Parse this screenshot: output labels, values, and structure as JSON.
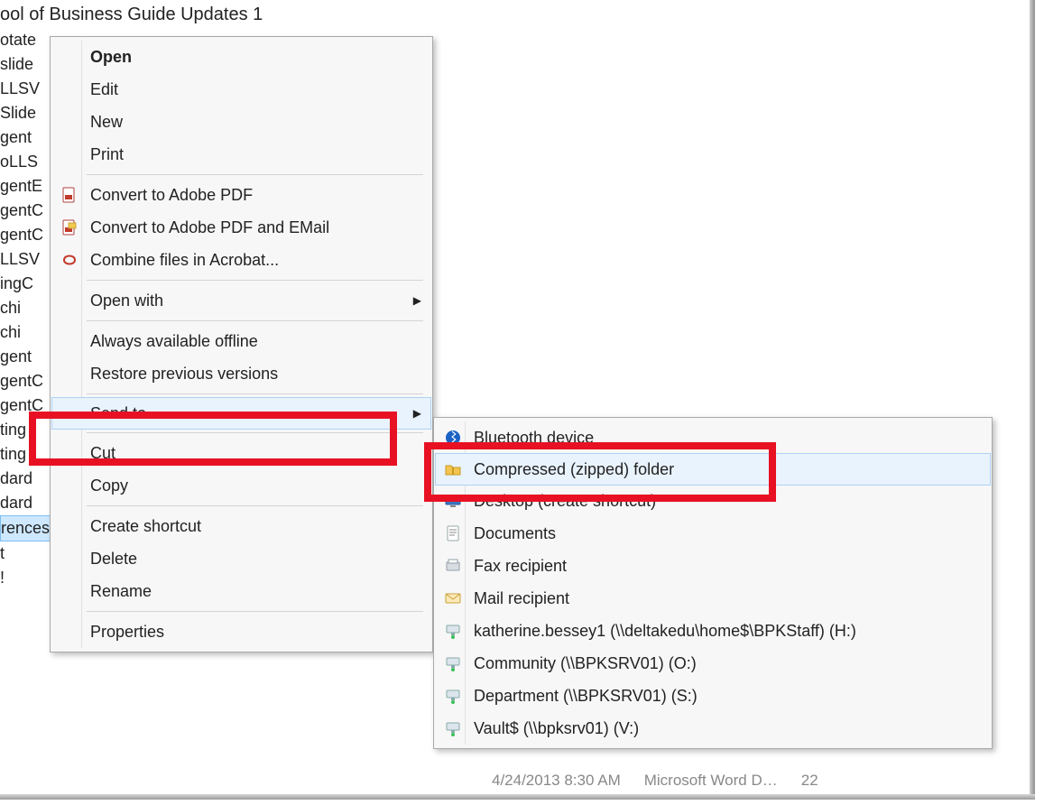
{
  "title": "ool of Business Guide Updates 1",
  "file_items": [
    "otate",
    "slide",
    "LLSV",
    "Slide",
    "gent",
    "oLLS",
    "gentE",
    "gentC",
    "gentC",
    "LLSV",
    "ingC",
    "chi",
    "chi",
    "gent",
    "gentC",
    "gentC",
    "ting",
    "ting",
    "dard",
    "dard",
    "rences",
    "t",
    "!"
  ],
  "file_selected_index": 20,
  "status": {
    "date": "4/24/2013 8:30 AM",
    "type": "Microsoft Word D…",
    "size": "22"
  },
  "menu1": {
    "groups": [
      {
        "items": [
          {
            "label": "Open",
            "bold": true
          },
          {
            "label": "Edit"
          },
          {
            "label": "New"
          },
          {
            "label": "Print"
          }
        ]
      },
      {
        "items": [
          {
            "label": "Convert to Adobe PDF",
            "icon": "pdf-icon"
          },
          {
            "label": "Convert to Adobe PDF and EMail",
            "icon": "pdf-mail-icon"
          },
          {
            "label": "Combine files in Acrobat...",
            "icon": "acrobat-icon"
          }
        ]
      },
      {
        "items": [
          {
            "label": "Open with",
            "submenu": true
          }
        ]
      },
      {
        "items": [
          {
            "label": "Always available offline"
          },
          {
            "label": "Restore previous versions"
          }
        ]
      },
      {
        "items": [
          {
            "label": "Send to",
            "submenu": true,
            "hover": true
          }
        ]
      },
      {
        "items": [
          {
            "label": "Cut"
          },
          {
            "label": "Copy"
          }
        ]
      },
      {
        "items": [
          {
            "label": "Create shortcut"
          },
          {
            "label": "Delete"
          },
          {
            "label": "Rename"
          }
        ]
      },
      {
        "items": [
          {
            "label": "Properties"
          }
        ]
      }
    ]
  },
  "menu2": {
    "items": [
      {
        "label": "Bluetooth device",
        "icon": "bluetooth-icon"
      },
      {
        "label": "Compressed (zipped) folder",
        "icon": "zip-folder-icon",
        "hover": true
      },
      {
        "label": "Desktop (create shortcut)",
        "icon": "desktop-icon"
      },
      {
        "label": "Documents",
        "icon": "document-icon"
      },
      {
        "label": "Fax recipient",
        "icon": "fax-icon"
      },
      {
        "label": "Mail recipient",
        "icon": "mail-icon"
      },
      {
        "label": "katherine.bessey1 (\\\\deltakedu\\home$\\BPKStaff) (H:)",
        "icon": "network-drive-icon"
      },
      {
        "label": "Community (\\\\BPKSRV01) (O:)",
        "icon": "network-drive-icon"
      },
      {
        "label": "Department (\\\\BPKSRV01) (S:)",
        "icon": "network-drive-icon"
      },
      {
        "label": "Vault$ (\\\\bpksrv01) (V:)",
        "icon": "network-drive-icon"
      }
    ]
  }
}
